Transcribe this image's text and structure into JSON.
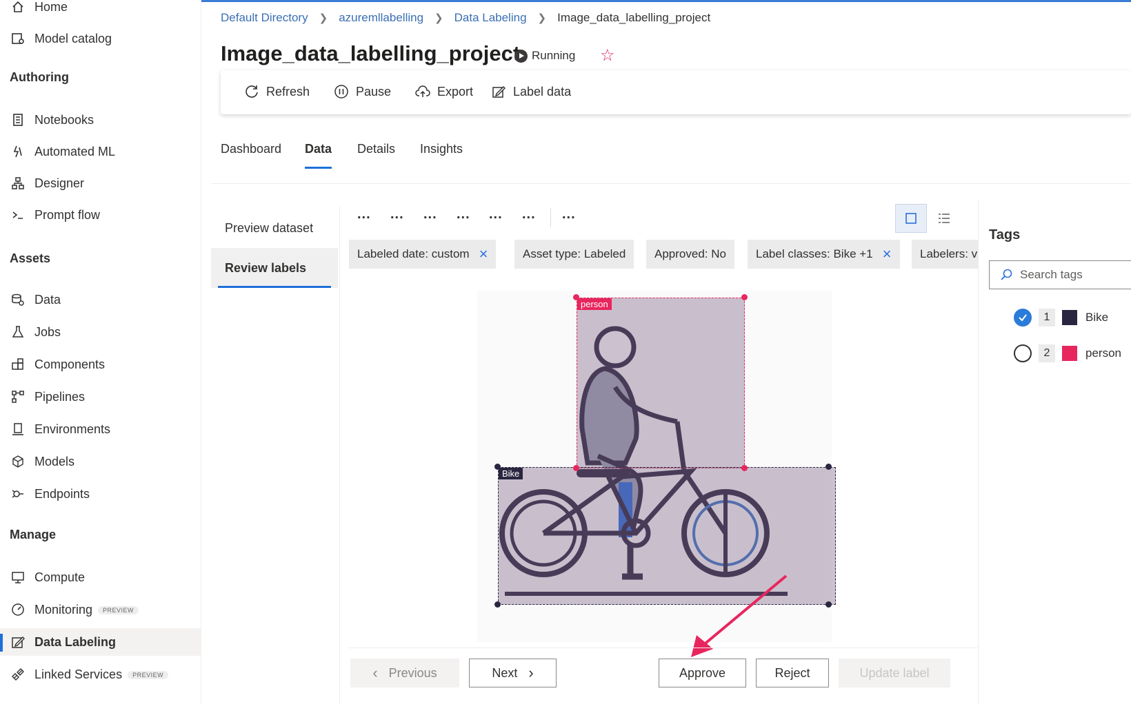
{
  "sidebar": {
    "items_top": [
      {
        "label": "Home",
        "icon": "home-icon"
      },
      {
        "label": "Model catalog",
        "icon": "catalog-icon"
      }
    ],
    "sections": [
      {
        "title": "Authoring"
      },
      {
        "title": "Assets"
      },
      {
        "title": "Manage"
      }
    ],
    "authoring": [
      {
        "label": "Notebooks",
        "icon": "notebook-icon"
      },
      {
        "label": "Automated ML",
        "icon": "automl-icon"
      },
      {
        "label": "Designer",
        "icon": "designer-icon"
      },
      {
        "label": "Prompt flow",
        "icon": "prompt-flow-icon"
      }
    ],
    "assets": [
      {
        "label": "Data",
        "icon": "data-icon"
      },
      {
        "label": "Jobs",
        "icon": "flask-icon"
      },
      {
        "label": "Components",
        "icon": "components-icon"
      },
      {
        "label": "Pipelines",
        "icon": "pipelines-icon"
      },
      {
        "label": "Environments",
        "icon": "environments-icon"
      },
      {
        "label": "Models",
        "icon": "models-icon"
      },
      {
        "label": "Endpoints",
        "icon": "endpoints-icon"
      }
    ],
    "manage": [
      {
        "label": "Compute",
        "icon": "compute-icon"
      },
      {
        "label": "Monitoring",
        "icon": "monitoring-icon",
        "badge": "PREVIEW"
      },
      {
        "label": "Data Labeling",
        "icon": "data-labeling-icon",
        "active": true
      },
      {
        "label": "Linked Services",
        "icon": "linked-services-icon",
        "badge": "PREVIEW"
      }
    ]
  },
  "breadcrumb": [
    "Default Directory",
    "azuremllabelling",
    "Data Labeling",
    "Image_data_labelling_project"
  ],
  "project": {
    "title": "Image_data_labelling_project",
    "status": "Running"
  },
  "toolbar": {
    "refresh": "Refresh",
    "pause": "Pause",
    "export": "Export",
    "label_data": "Label data"
  },
  "tabs": [
    "Dashboard",
    "Data",
    "Details",
    "Insights"
  ],
  "active_tab": "Data",
  "subnav": [
    "Preview dataset",
    "Review labels"
  ],
  "active_subnav": "Review labels",
  "dots": [
    "...",
    "...",
    "...",
    "...",
    "...",
    "...",
    "..."
  ],
  "filters": [
    {
      "label": "Labeled date: custom",
      "removable": true
    },
    {
      "label": "Asset type: Labeled",
      "removable": false
    },
    {
      "label": "Approved: No",
      "removable": false
    },
    {
      "label": "Label classes: Bike +1",
      "removable": true
    },
    {
      "label": "Labelers: v",
      "removable": false
    }
  ],
  "annotations": [
    {
      "label": "person",
      "color": "#e8265e"
    },
    {
      "label": "Bike",
      "color": "#2a2640"
    }
  ],
  "buttons": {
    "previous": "Previous",
    "next": "Next",
    "approve": "Approve",
    "reject": "Reject",
    "update": "Update label"
  },
  "tags": {
    "title": "Tags",
    "search_placeholder": "Search tags",
    "items": [
      {
        "num": "1",
        "name": "Bike",
        "color": "#2a2640",
        "checked": true
      },
      {
        "num": "2",
        "name": "person",
        "color": "#e8265e",
        "checked": false
      }
    ]
  },
  "colors": {
    "accent": "#1e6fd9",
    "annotation_arrow": "#e8265e"
  }
}
